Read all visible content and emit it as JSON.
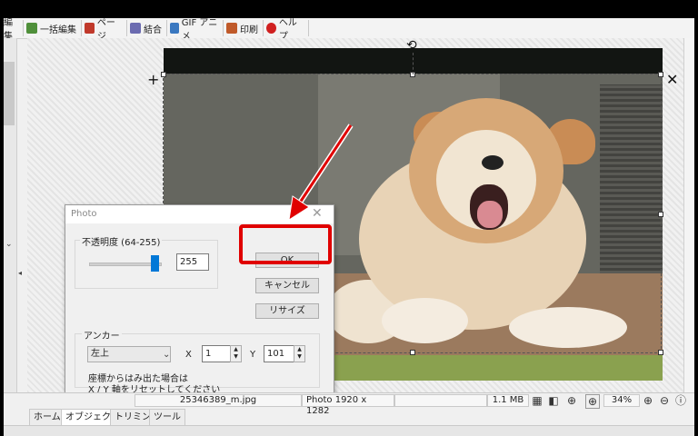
{
  "top_tabs": [
    {
      "label": "編集",
      "icon": "edit-icon",
      "color": "#3a6fb0"
    },
    {
      "label": "一括編集",
      "icon": "batch-edit-icon",
      "color": "#4f8f3a"
    },
    {
      "label": "ページ",
      "icon": "page-icon",
      "color": "#c0392b"
    },
    {
      "label": "結合",
      "icon": "combine-icon",
      "color": "#6b6bb0"
    },
    {
      "label": "GIF アニメ",
      "icon": "gif-anime-icon",
      "color": "#3a78c0"
    },
    {
      "label": "印刷",
      "icon": "print-icon",
      "color": "#c05a2a"
    },
    {
      "label": "ヘルプ",
      "icon": "help-icon",
      "color": "#d02020"
    }
  ],
  "dialog": {
    "title": "Photo",
    "opacity_label": "不透明度 (64-255)",
    "opacity_value": "255",
    "opacity_level": 1.0,
    "ok_label": "OK",
    "cancel_label": "キャンセル",
    "resize_label": "リサイズ",
    "anchor_label": "アンカー",
    "anchor_value": "左上",
    "x_label": "X",
    "x_value": "1",
    "y_label": "Y",
    "y_value": "101",
    "note_line1": "座標からはみ出た場合は",
    "note_line2": "X / Y 軸をリセットしてください"
  },
  "status": {
    "filename": "25346389_m.jpg",
    "photo_info": "Photo 1920 x 1282",
    "filesize": "1.1 MB",
    "zoom": "34%"
  },
  "bottom_tabs": [
    "ホーム",
    "オブジェクト",
    "トリミング",
    "ツール"
  ],
  "active_bottom_tab": "オブジェクト",
  "colors": {
    "highlight": "#e00000",
    "accent": "#0078d7"
  }
}
